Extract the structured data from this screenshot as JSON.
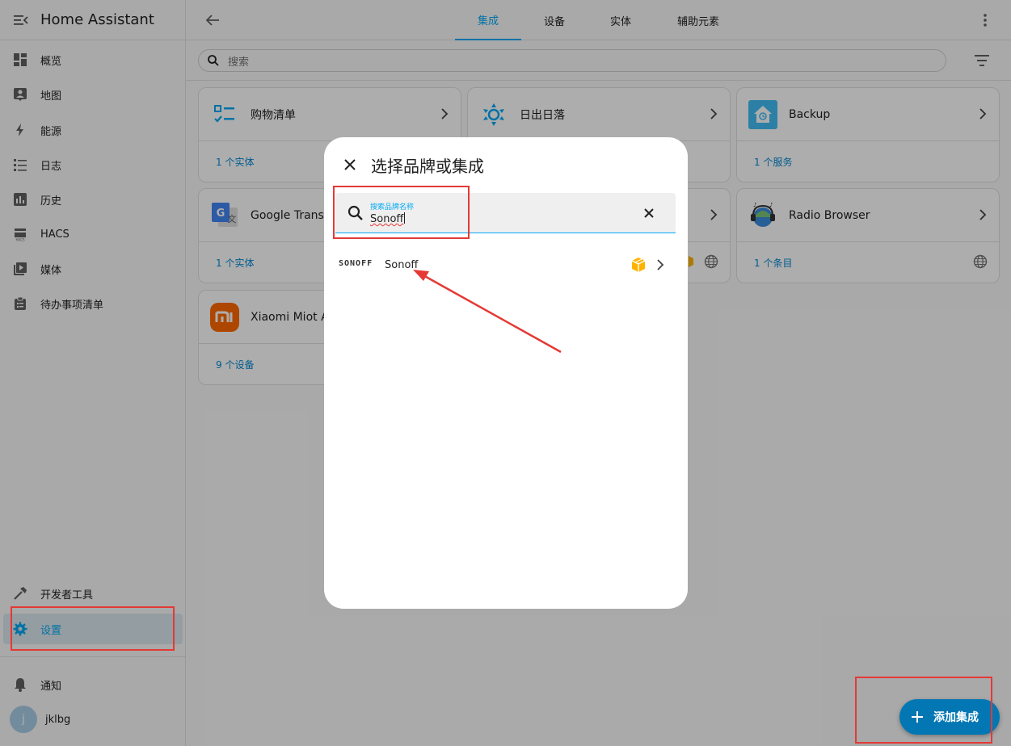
{
  "app": {
    "title": "Home Assistant"
  },
  "sidebar": {
    "items": [
      {
        "label": "概览",
        "icon": "dashboard-icon"
      },
      {
        "label": "地图",
        "icon": "map-icon"
      },
      {
        "label": "能源",
        "icon": "lightning-icon"
      },
      {
        "label": "日志",
        "icon": "list-icon"
      },
      {
        "label": "历史",
        "icon": "chart-icon"
      },
      {
        "label": "HACS",
        "icon": "hacs-icon"
      },
      {
        "label": "媒体",
        "icon": "media-icon"
      },
      {
        "label": "待办事项清单",
        "icon": "clipboard-icon"
      }
    ],
    "dev_tools": "开发者工具",
    "settings": "设置",
    "notifications": "通知",
    "user": {
      "initial": "j",
      "name": "jklbg"
    }
  },
  "tabs": [
    "集成",
    "设备",
    "实体",
    "辅助元素"
  ],
  "search": {
    "placeholder": "搜索"
  },
  "cards": [
    {
      "name": "购物清单",
      "footer": "1 个实体",
      "icon": "shopping-list-icon"
    },
    {
      "name": "日出日落",
      "footer": "",
      "icon": "sun-icon"
    },
    {
      "name": "Backup",
      "footer": "1 个服务",
      "icon": "backup-icon"
    },
    {
      "name": "Google Translate",
      "footer": "1 个实体",
      "icon": "google-translate-icon"
    },
    {
      "name": "",
      "footer": "",
      "icon": ""
    },
    {
      "name": "Radio Browser",
      "footer": "1 个条目",
      "icon": "radio-browser-icon"
    },
    {
      "name": "Xiaomi Miot Auto",
      "footer": "9 个设备",
      "icon": "xiaomi-icon"
    }
  ],
  "dialog": {
    "title": "选择品牌或集成",
    "search_label": "搜索品牌名称",
    "search_value": "Sonoff",
    "result": {
      "logo_text": "SONOFF",
      "name": "Sonoff"
    }
  },
  "fab": {
    "label": "添加集成"
  },
  "colors": {
    "accent": "#03a9f4",
    "fab": "#0277b3",
    "annotation": "#e53935"
  }
}
